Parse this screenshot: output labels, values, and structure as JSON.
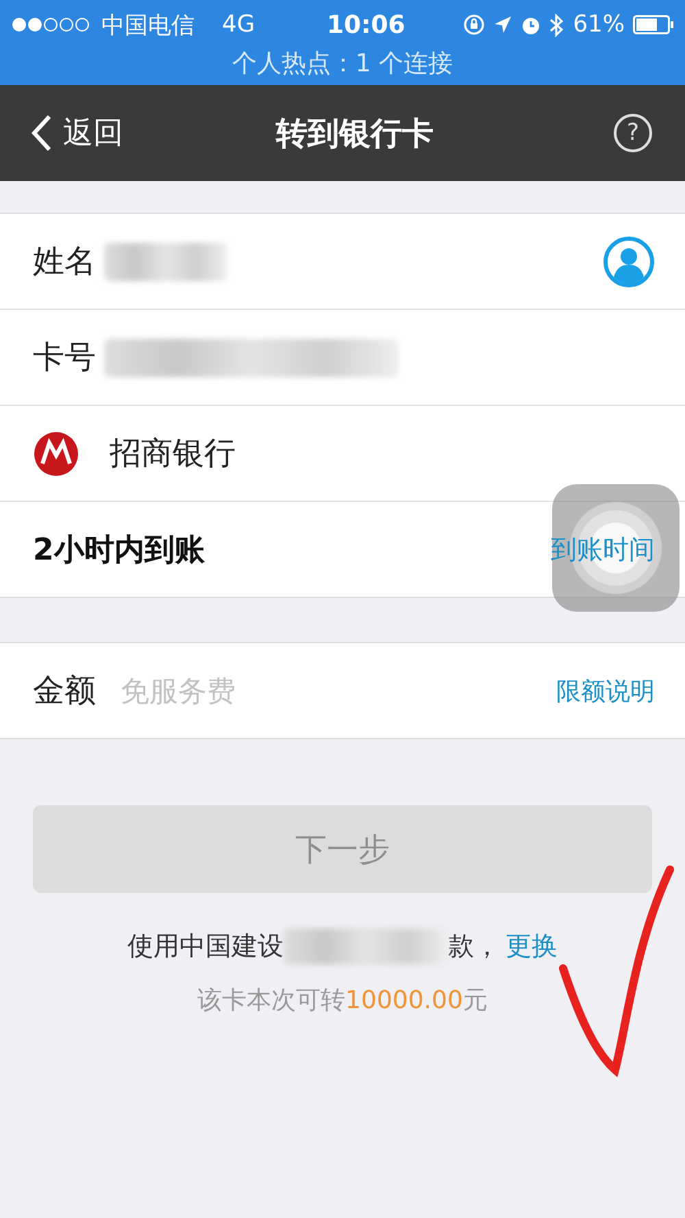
{
  "status_bar": {
    "carrier": "中国电信",
    "network": "4G",
    "time": "10:06",
    "battery": "61%",
    "hotspot": "个人热点：1 个连接"
  },
  "nav_bar": {
    "back": "返回",
    "title": "转到银行卡",
    "help": "?"
  },
  "recipient": {
    "name_label": "姓名",
    "card_label": "卡号",
    "bank": "招商银行",
    "arrival": "2小时内到账",
    "arrival_link": "到账时间"
  },
  "amount": {
    "label": "金额",
    "placeholder": "免服务费",
    "link": "限额说明"
  },
  "next_button": {
    "label": "下一步",
    "disabled": true
  },
  "payment": {
    "prefix": "使用中国建设",
    "suffix": "款，",
    "change": "更换",
    "limit_prefix": "该卡本次可转",
    "limit_amount": "10000.00",
    "limit_unit": "元"
  }
}
